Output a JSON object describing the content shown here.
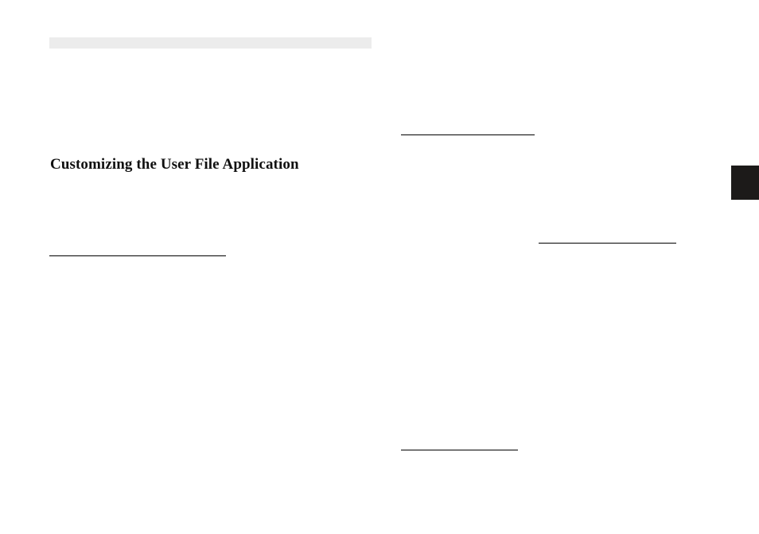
{
  "heading": "Customizing the User File Application"
}
